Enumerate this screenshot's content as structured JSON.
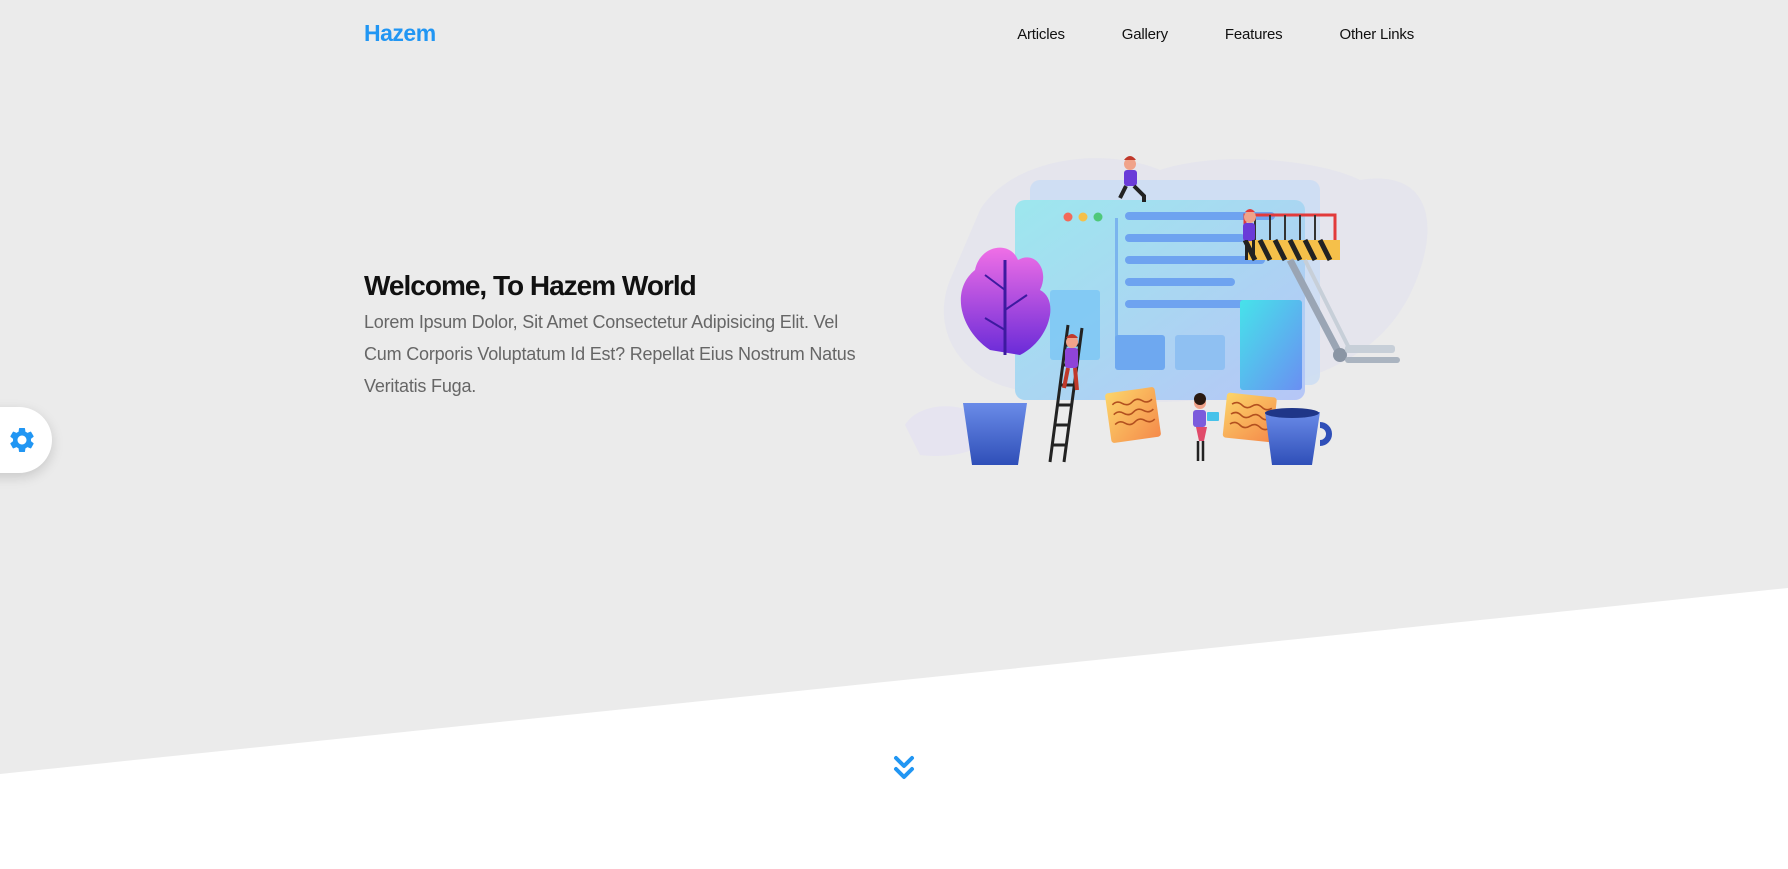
{
  "header": {
    "logo": "Hazem",
    "nav": [
      "Articles",
      "Gallery",
      "Features",
      "Other Links"
    ]
  },
  "hero": {
    "title": "Welcome, To Hazem World",
    "description": "Lorem Ipsum Dolor, Sit Amet Consectetur Adipisicing Elit. Vel Cum Corporis Voluptatum Id Est? Repellat Eius Nostrum Natus Veritatis Fuga."
  },
  "icons": {
    "settings": "gear-icon",
    "scroll": "double-chevron-down-icon"
  },
  "colors": {
    "accent": "#2196f3",
    "background": "#ebebeb",
    "heading": "#111111",
    "text": "#666666"
  }
}
